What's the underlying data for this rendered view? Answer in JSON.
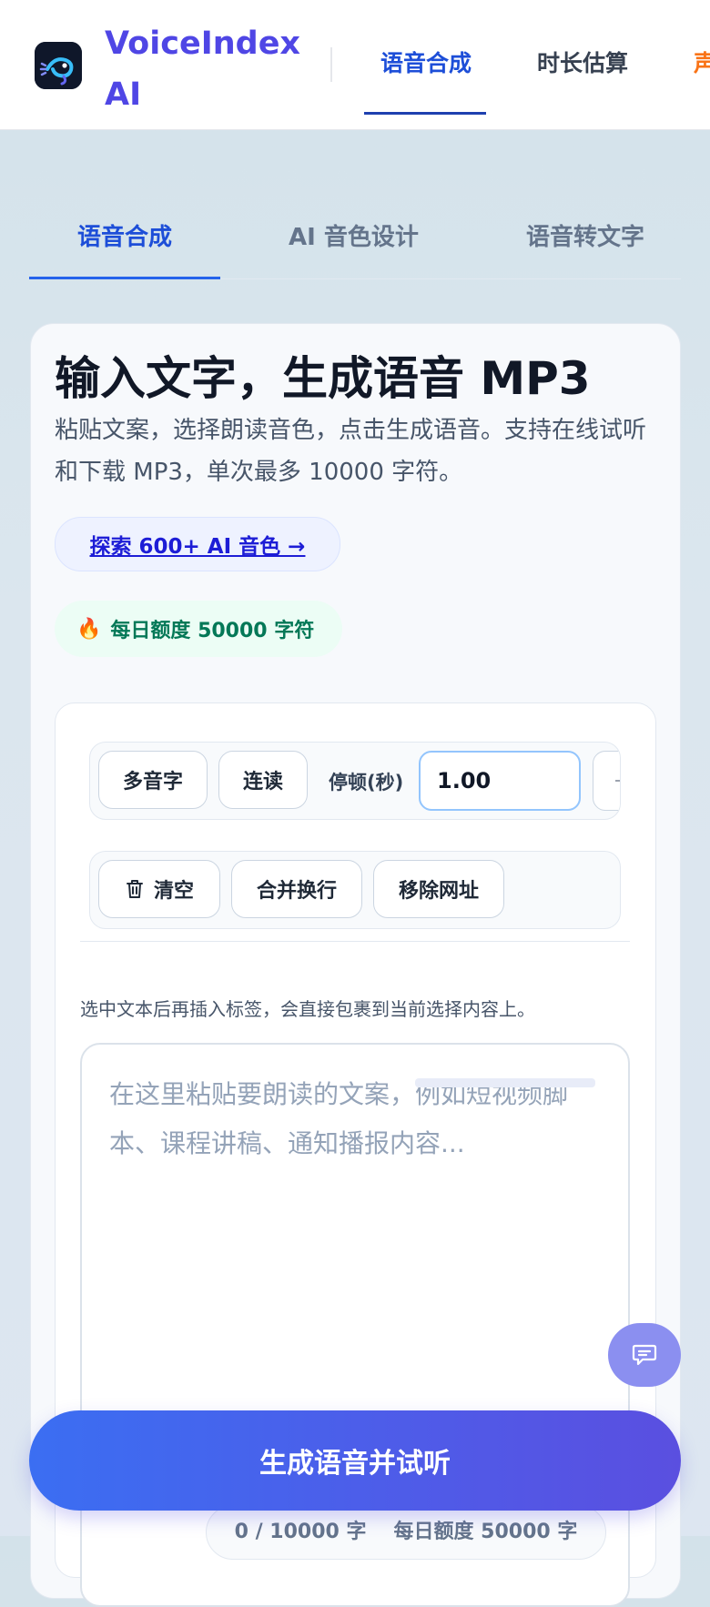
{
  "header": {
    "brand": "VoiceIndex AI",
    "nav": [
      {
        "label": "语音合成",
        "active": true
      },
      {
        "label": "时长估算",
        "active": false
      },
      {
        "label": "声",
        "active": false
      }
    ]
  },
  "tabs": [
    {
      "label": "语音合成",
      "active": true
    },
    {
      "label": "AI 音色设计",
      "active": false
    },
    {
      "label": "语音转文字",
      "active": false
    }
  ],
  "main": {
    "title": "输入文字，生成语音 MP3",
    "subtitle": "粘贴文案，选择朗读音色，点击生成语音。支持在线试听和下载 MP3，单次最多 10000 字符。",
    "explore_link": "探索 600+ AI 音色 →",
    "quota_badge": "每日额度 50000 字符"
  },
  "toolbar": {
    "polyphone": "多音字",
    "liaison": "连读",
    "pause_label": "停顿(秒)",
    "pause_value": "1.00",
    "clear": "清空",
    "merge_lines": "合并换行",
    "remove_urls": "移除网址"
  },
  "editor": {
    "hint": "选中文本后再插入标签，会直接包裹到当前选择内容上。",
    "placeholder": "在这里粘贴要朗读的文案，例如短视频脚本、课程讲稿、通知播报内容..."
  },
  "actions": {
    "generate": "生成语音并试听"
  },
  "counter": {
    "chars": "0 / 10000 字",
    "daily": "每日额度 50000 字"
  },
  "colors": {
    "accent": "#4f46e5",
    "link": "#1d1dd6",
    "success": "#047857"
  }
}
